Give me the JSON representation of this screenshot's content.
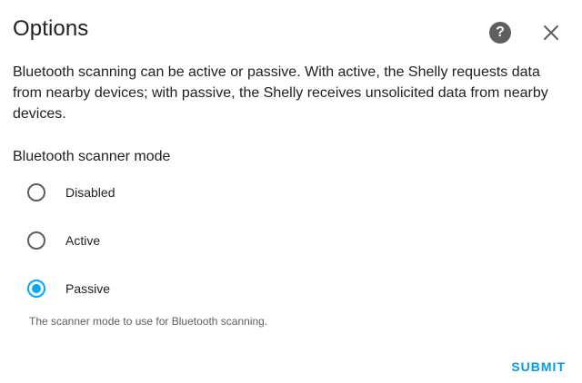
{
  "dialog": {
    "title": "Options",
    "help_icon": "help-circle-icon",
    "help_glyph": "?",
    "close_icon": "close-icon",
    "description": "Bluetooth scanning can be active or passive. With active, the Shelly requests data from nearby devices; with passive, the Shelly receives unsolicited data from nearby devices."
  },
  "form": {
    "field_label": "Bluetooth scanner mode",
    "options": [
      {
        "label": "Disabled",
        "selected": false
      },
      {
        "label": "Active",
        "selected": false
      },
      {
        "label": "Passive",
        "selected": true
      }
    ],
    "helper_text": "The scanner mode to use for Bluetooth scanning."
  },
  "actions": {
    "submit_label": "SUBMIT"
  },
  "colors": {
    "accent": "#03a9f4",
    "text": "#212121",
    "secondary_text": "#5f5f5f"
  }
}
